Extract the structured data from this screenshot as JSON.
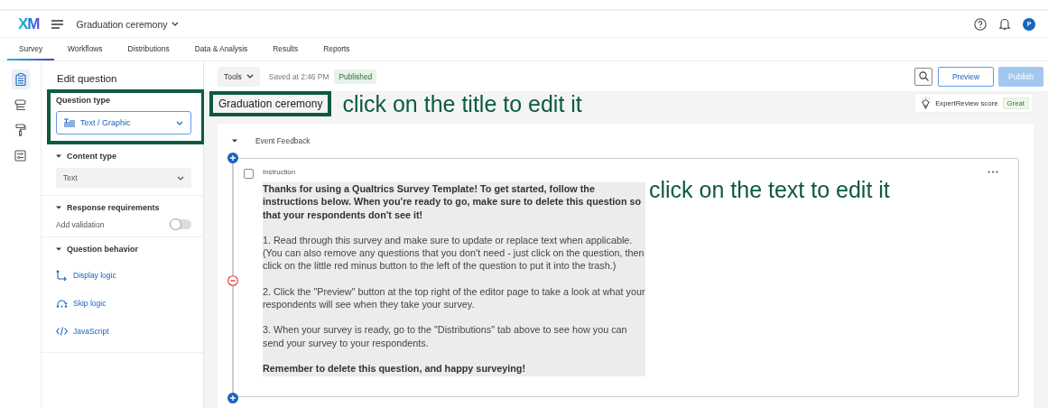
{
  "top_bar": {
    "logo": "XM",
    "project_title": "Graduation ceremony",
    "avatar_initial": "P"
  },
  "tabs": [
    {
      "label": "Survey",
      "selected": true
    },
    {
      "label": "Workflows",
      "selected": false
    },
    {
      "label": "Distributions",
      "selected": false
    },
    {
      "label": "Data & Analysis",
      "selected": false
    },
    {
      "label": "Results",
      "selected": false
    },
    {
      "label": "Reports",
      "selected": false
    }
  ],
  "side_rail": [
    {
      "kind": "survey",
      "selected": true
    },
    {
      "kind": "blocks",
      "selected": false
    },
    {
      "kind": "style",
      "selected": false
    },
    {
      "kind": "options",
      "selected": false
    }
  ],
  "edit_panel": {
    "heading": "Edit question",
    "question_type": {
      "label": "Question type",
      "value": "Text / Graphic"
    },
    "sections": [
      {
        "kind": "dropdown",
        "title": "Content type",
        "expanded": true,
        "value": "Text"
      },
      {
        "kind": "toggle",
        "title": "Response requirements",
        "expanded": true,
        "label": "Add validation",
        "on": false
      },
      {
        "kind": "links",
        "title": "Question behavior",
        "expanded": true,
        "links": [
          {
            "kind": "display",
            "label": "Display logic"
          },
          {
            "kind": "skip",
            "label": "Skip logic"
          },
          {
            "kind": "code",
            "label": "JavaScript"
          }
        ]
      }
    ]
  },
  "toolbar": {
    "tools": "Tools",
    "saved": "Saved at 2:46 PM",
    "status": "Published",
    "preview": "Preview",
    "publish": {
      "label": "Publish",
      "disabled": true
    }
  },
  "survey": {
    "title": "Graduation ceremony",
    "expert_review": {
      "label": "ExpertReview score",
      "score": "Great"
    },
    "block": {
      "name": "Event Feedback",
      "expanded": true,
      "question": {
        "type_label": "Instruction",
        "checked": false,
        "paragraphs": [
          {
            "text": "Thanks for using a Qualtrics Survey Template! To get started, follow the instructions below. When you're ready to go, make sure to delete this question so that your respondents don't see it!",
            "bold": true
          },
          {
            "text": "1. Read through this survey and make sure to update or replace text when applicable. (You can also remove any questions that you don't need - just click on the question, then click on the little red minus button to the left of the question to put it into the trash.)",
            "bold": false
          },
          {
            "text": "2. Click the \"Preview\" button at the top right of the editor page to take a look at what your respondents will see when they take your survey.",
            "bold": false
          },
          {
            "text": "3. When your survey is ready, go to the \"Distributions\" tab above to see how you can send your survey to your respondents.",
            "bold": false
          },
          {
            "text": "Remember to delete this question, and happy surveying!",
            "bold": true
          }
        ]
      }
    }
  },
  "annotations": [
    {
      "text": "click on the title to edit it"
    },
    {
      "text": "click on the text to edit it"
    }
  ]
}
